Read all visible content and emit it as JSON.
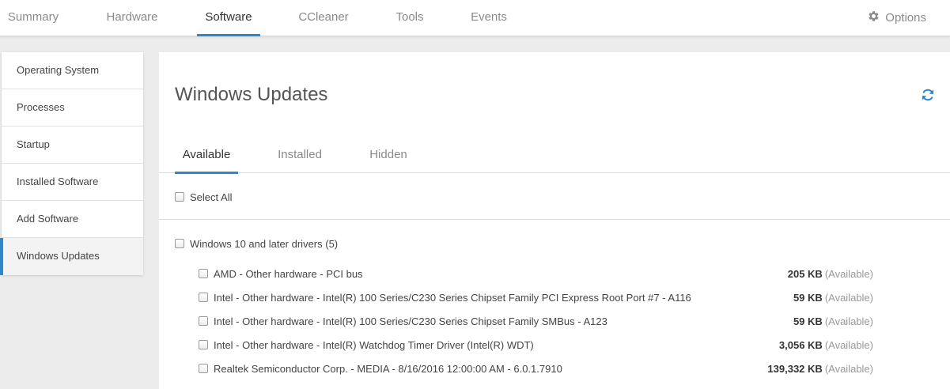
{
  "nav": {
    "tabs": [
      {
        "label": "Summary"
      },
      {
        "label": "Hardware"
      },
      {
        "label": "Software"
      },
      {
        "label": "CCleaner"
      },
      {
        "label": "Tools"
      },
      {
        "label": "Events"
      }
    ],
    "active_tab": "Software",
    "options_label": "Options",
    "options_icon": "gear-icon"
  },
  "sidebar": {
    "items": [
      {
        "label": "Operating System"
      },
      {
        "label": "Processes"
      },
      {
        "label": "Startup"
      },
      {
        "label": "Installed Software"
      },
      {
        "label": "Add Software"
      },
      {
        "label": "Windows Updates"
      }
    ],
    "active_item": "Windows Updates"
  },
  "main": {
    "title": "Windows Updates",
    "refresh_icon": "refresh-icon",
    "subtabs": [
      {
        "label": "Available"
      },
      {
        "label": "Installed"
      },
      {
        "label": "Hidden"
      }
    ],
    "active_subtab": "Available",
    "select_all_label": "Select All",
    "group_label": "Windows 10 and later drivers (5)",
    "updates": [
      {
        "name": "AMD - Other hardware - PCI bus",
        "size": "205 KB",
        "status": "(Available)"
      },
      {
        "name": "Intel - Other hardware - Intel(R) 100 Series/C230 Series Chipset Family PCI Express Root Port #7 - A116",
        "size": "59 KB",
        "status": "(Available)"
      },
      {
        "name": "Intel - Other hardware - Intel(R) 100 Series/C230 Series Chipset Family SMBus - A123",
        "size": "59 KB",
        "status": "(Available)"
      },
      {
        "name": "Intel - Other hardware - Intel(R) Watchdog Timer Driver (Intel(R) WDT)",
        "size": "3,056 KB",
        "status": "(Available)"
      },
      {
        "name": "Realtek Semiconductor Corp. - MEDIA - 8/16/2016 12:00:00 AM - 6.0.1.7910",
        "size": "139,332 KB",
        "status": "(Available)"
      }
    ]
  },
  "colors": {
    "accent": "#2f86c8",
    "background": "#ececec",
    "panel": "#ffffff",
    "muted_text": "#8a8a8a"
  }
}
